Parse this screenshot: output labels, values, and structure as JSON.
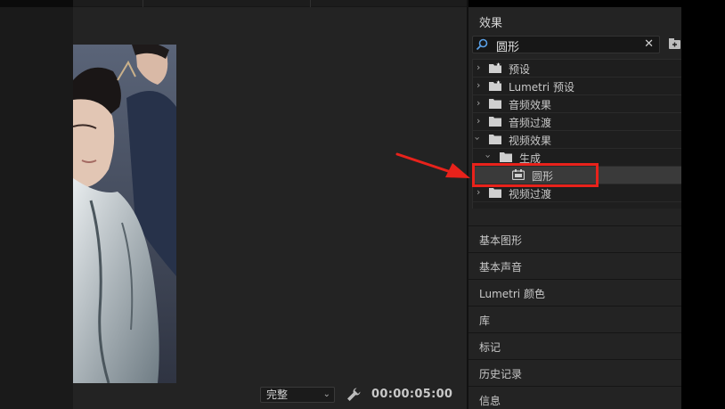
{
  "monitor": {
    "quality_value": "完整",
    "timecode": "00:00:05:00"
  },
  "effects_panel": {
    "title": "效果",
    "search_value": "圆形",
    "clear_symbol": "✕",
    "tree": [
      {
        "label": "预设",
        "icon": "preset-folder-icon",
        "expanded": false,
        "level": 0
      },
      {
        "label": "Lumetri 预设",
        "icon": "preset-folder-icon",
        "expanded": false,
        "level": 0
      },
      {
        "label": "音频效果",
        "icon": "folder-icon",
        "expanded": false,
        "level": 0
      },
      {
        "label": "音频过渡",
        "icon": "folder-icon",
        "expanded": false,
        "level": 0
      },
      {
        "label": "视频效果",
        "icon": "folder-icon",
        "expanded": true,
        "level": 0
      },
      {
        "label": "生成",
        "icon": "folder-icon",
        "expanded": true,
        "level": 1
      },
      {
        "label": "圆形",
        "icon": "effect-icon",
        "selected": true,
        "level": 2
      },
      {
        "label": "视频过渡",
        "icon": "folder-icon",
        "expanded": false,
        "level": 0
      }
    ]
  },
  "sections": [
    {
      "label": "基本图形"
    },
    {
      "label": "基本声音"
    },
    {
      "label": "Lumetri 颜色"
    },
    {
      "label": "库"
    },
    {
      "label": "标记"
    },
    {
      "label": "历史记录"
    },
    {
      "label": "信息"
    }
  ],
  "colors": {
    "highlight": "#e8221b",
    "panel_bg": "#232323",
    "tree_bg": "#1e1e1e"
  }
}
